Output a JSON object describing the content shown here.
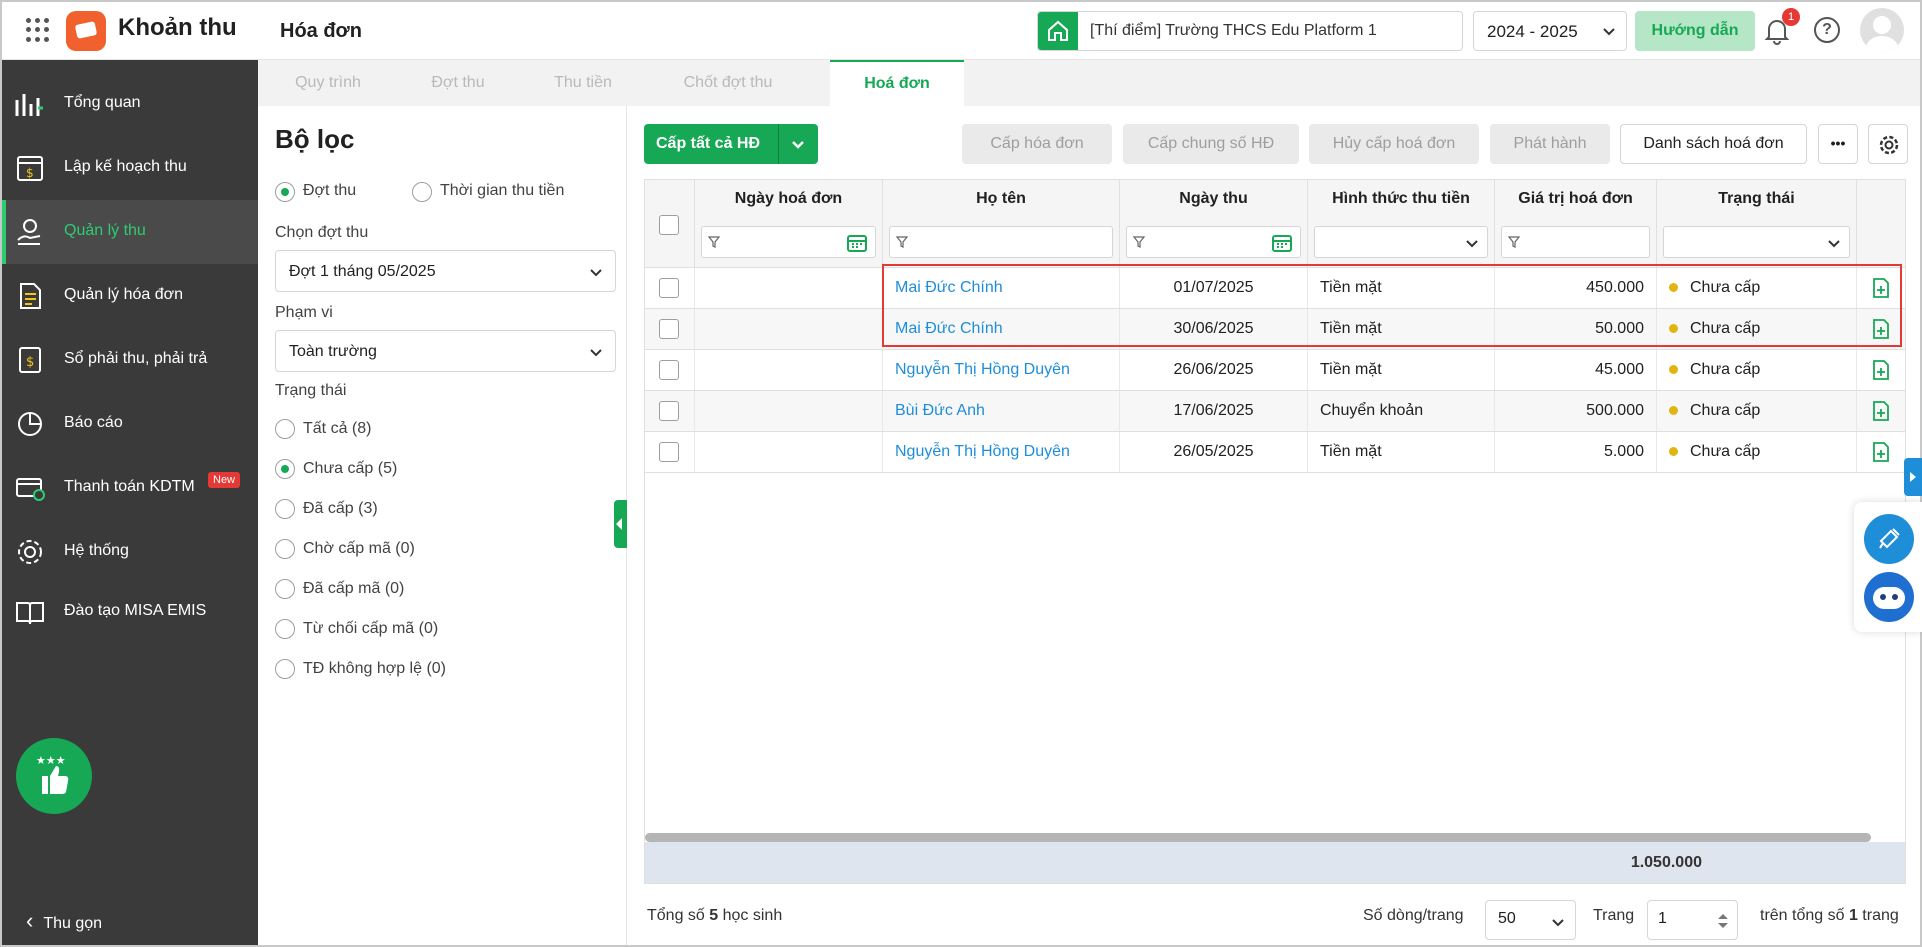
{
  "topbar": {
    "app_name": "Khoản thu",
    "page_title": "Hóa đơn",
    "school": "[Thí điểm] Trường THCS Edu Platform 1",
    "year": "2024 - 2025",
    "guide_label": "Hướng dẫn",
    "notification_count": "1",
    "help_icon": "?"
  },
  "sidebar": {
    "items": [
      {
        "label": "Tổng quan",
        "icon": "bar-chart-icon"
      },
      {
        "label": "Lập kế hoạch thu",
        "icon": "calendar-money-icon"
      },
      {
        "label": "Quản lý thu",
        "icon": "hand-coin-icon",
        "active": true
      },
      {
        "label": "Quản lý hóa đơn",
        "icon": "document-icon"
      },
      {
        "label": "Sổ phải thu, phải trả",
        "icon": "ledger-icon"
      },
      {
        "label": "Báo cáo",
        "icon": "pie-chart-icon"
      },
      {
        "label": "Thanh toán KDTM",
        "icon": "card-check-icon"
      },
      {
        "label": "Hệ thống",
        "icon": "gear-icon"
      },
      {
        "label": "Đào tạo MISA EMIS",
        "icon": "book-icon"
      }
    ],
    "new_badge": "New",
    "collapse_label": "Thu gọn",
    "collapse_icon": "‹"
  },
  "tabs": [
    "Quy trình",
    "Đợt thu",
    "Thu tiền",
    "Chốt đợt thu",
    "Hoá đơn"
  ],
  "filter": {
    "title": "Bộ lọc",
    "mode_options": [
      "Đợt thu",
      "Thời gian thu tiền"
    ],
    "period_label": "Chọn đợt thu",
    "period_value": "Đợt 1 tháng 05/2025",
    "scope_label": "Phạm vi",
    "scope_value": "Toàn trường",
    "status_label": "Trạng thái",
    "status_options": [
      "Tất cả (8)",
      "Chưa cấp (5)",
      "Đã cấp (3)",
      "Chờ cấp mã (0)",
      "Đã cấp mã (0)",
      "Từ chối cấp mã (0)",
      "TĐ không hợp lệ (0)"
    ]
  },
  "toolbar": {
    "issue_all": "Cấp tất cả HĐ",
    "issue": "Cấp hóa đơn",
    "issue_shared": "Cấp chung số HĐ",
    "cancel_issue": "Hủy cấp hoá đơn",
    "publish": "Phát hành",
    "invoice_list": "Danh sách hoá đơn",
    "more": "•••"
  },
  "table": {
    "columns": [
      "Ngày hoá đơn",
      "Họ tên",
      "Ngày thu",
      "Hình thức thu tiền",
      "Giá trị hoá đơn",
      "Trạng thái"
    ],
    "rows": [
      {
        "date": "",
        "name": "Mai Đức Chính",
        "paid": "01/07/2025",
        "method": "Tiền mặt",
        "amount": "450.000",
        "status": "Chưa cấp"
      },
      {
        "date": "",
        "name": "Mai Đức Chính",
        "paid": "30/06/2025",
        "method": "Tiền mặt",
        "amount": "50.000",
        "status": "Chưa cấp"
      },
      {
        "date": "",
        "name": "Nguyễn Thị Hồng Duyên",
        "paid": "26/06/2025",
        "method": "Tiền mặt",
        "amount": "45.000",
        "status": "Chưa cấp"
      },
      {
        "date": "",
        "name": "Bùi Đức Anh",
        "paid": "17/06/2025",
        "method": "Chuyển khoản",
        "amount": "500.000",
        "status": "Chưa cấp"
      },
      {
        "date": "",
        "name": "Nguyễn Thị Hồng Duyên",
        "paid": "26/05/2025",
        "method": "Tiền mặt",
        "amount": "5.000",
        "status": "Chưa cấp"
      }
    ],
    "total": "1.050.000"
  },
  "footer": {
    "total_prefix": "Tổng số ",
    "total_count": "5",
    "total_suffix": " học sinh",
    "rows_per_page_label": "Số dòng/trang",
    "rows_per_page": "50",
    "page_label": "Trang",
    "page": "1",
    "of_prefix": "trên tổng số ",
    "of_count": "1",
    "of_suffix": " trang"
  },
  "colors": {
    "primary": "#17a855",
    "sidebar": "#3a3a3a",
    "link": "#1f8ed8",
    "highlight": "#e53935"
  }
}
